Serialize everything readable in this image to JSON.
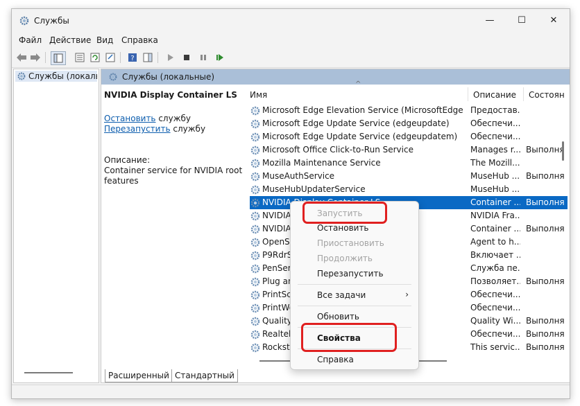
{
  "window": {
    "title": "Службы",
    "minimize": "—",
    "maximize": "☐",
    "close": "✕"
  },
  "menu": [
    "Файл",
    "Действие",
    "Вид",
    "Справка"
  ],
  "tree": {
    "item": "Службы (локалы"
  },
  "main": {
    "header": "Службы (локальные)",
    "selected_service": "NVIDIA Display Container LS",
    "stop_link": "Остановить",
    "stop_suffix": " службу",
    "restart_link": "Перезапустить",
    "restart_suffix": " службу",
    "desc_label": "Описание:",
    "desc_text_1": "Container service for NVIDIA root",
    "desc_text_2": "features"
  },
  "columns": {
    "name": "Имя",
    "description": "Описание",
    "status": "Состоян"
  },
  "rows": [
    {
      "name": "Microsoft Edge Elevation Service (MicrosoftEdgeElev...",
      "desc": "Предостав...",
      "status": ""
    },
    {
      "name": "Microsoft Edge Update Service (edgeupdate)",
      "desc": "Обеспечи...",
      "status": ""
    },
    {
      "name": "Microsoft Edge Update Service (edgeupdatem)",
      "desc": "Обеспечи...",
      "status": ""
    },
    {
      "name": "Microsoft Office Click-to-Run Service",
      "desc": "Manages r...",
      "status": "Выполня"
    },
    {
      "name": "Mozilla Maintenance Service",
      "desc": "The Mozill...",
      "status": ""
    },
    {
      "name": "MuseAuthService",
      "desc": "MuseHub ...",
      "status": "Выполня"
    },
    {
      "name": "MuseHubUpdaterService",
      "desc": "MuseHub ...",
      "status": ""
    },
    {
      "name": "NVIDIA Display Container LS",
      "desc": "Container ...",
      "status": "Выполня"
    },
    {
      "name": "NVIDIA",
      "desc": "NVIDIA Fra...",
      "status": ""
    },
    {
      "name": "NVIDIA",
      "desc": "Container ...",
      "status": "Выполня"
    },
    {
      "name": "OpenSS",
      "desc": "Agent to h...",
      "status": ""
    },
    {
      "name": "P9RdrSe",
      "desc": "Включает ...",
      "status": ""
    },
    {
      "name": "PenServ",
      "desc": "Служба пе...",
      "status": ""
    },
    {
      "name": "Plug an",
      "desc": "Позволяет...",
      "status": "Выполня"
    },
    {
      "name": "PrintSca",
      "desc": "Обеспечи...",
      "status": ""
    },
    {
      "name": "PrintWo",
      "desc": "Обеспечи...",
      "status": ""
    },
    {
      "name": "Quality",
      "desc": "Quality Wi...",
      "status": "Выполня"
    },
    {
      "name": "Realtek",
      "desc": "Обеспечи...",
      "status": "Выполня"
    },
    {
      "name": "Rockstar",
      "desc": "This servic...",
      "status": "Выполня"
    }
  ],
  "selected_row_index": 7,
  "tabs": {
    "extended": "Расширенный",
    "standard": "Стандартный"
  },
  "context_menu": {
    "start": "Запустить",
    "stop": "Остановить",
    "pause": "Приостановить",
    "resume": "Продолжить",
    "restart": "Перезапустить",
    "all_tasks": "Все задачи",
    "refresh": "Обновить",
    "properties": "Свойства",
    "help": "Справка"
  },
  "colors": {
    "accent": "#0a69c4",
    "highlight": "#e02020",
    "header": "#aabfd8"
  }
}
